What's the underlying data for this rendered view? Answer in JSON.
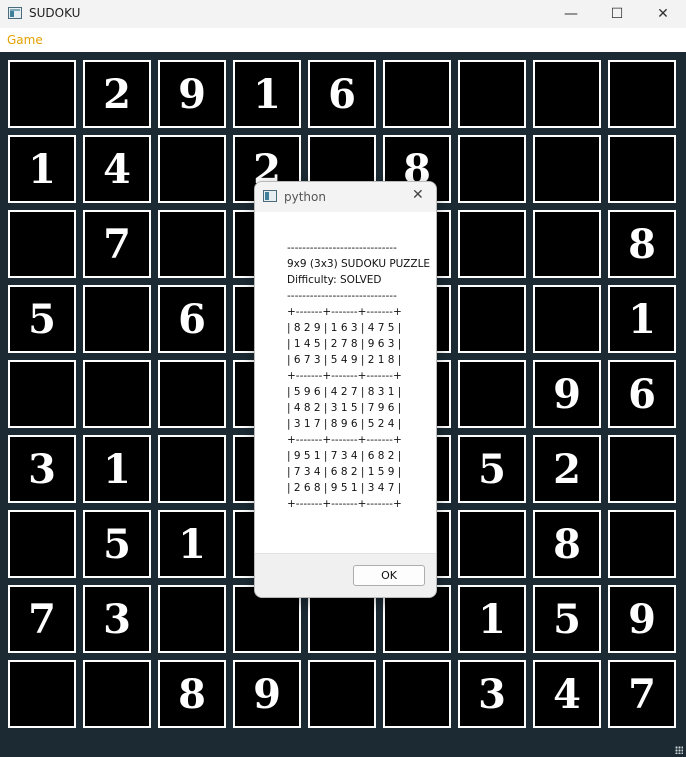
{
  "window": {
    "title": "SUDOKU",
    "controls": {
      "minimize": "—",
      "maximize": "☐",
      "close": "✕"
    }
  },
  "menu": {
    "items": [
      "Game"
    ]
  },
  "board": {
    "grid": [
      [
        "",
        "2",
        "9",
        "1",
        "6",
        "",
        "",
        "",
        ""
      ],
      [
        "1",
        "4",
        "",
        "2",
        "",
        "8",
        "",
        "",
        ""
      ],
      [
        "",
        "7",
        "",
        "",
        "",
        "",
        "",
        "",
        "8"
      ],
      [
        "5",
        "",
        "6",
        "",
        "",
        "",
        "",
        "",
        "1"
      ],
      [
        "",
        "",
        "",
        "",
        "",
        "",
        "",
        "9",
        "6"
      ],
      [
        "3",
        "1",
        "",
        "",
        "",
        "",
        "5",
        "2",
        ""
      ],
      [
        "",
        "5",
        "1",
        "",
        "",
        "",
        "",
        "8",
        ""
      ],
      [
        "7",
        "3",
        "",
        "",
        "",
        "",
        "1",
        "5",
        "9"
      ],
      [
        "",
        "",
        "8",
        "9",
        "",
        "",
        "3",
        "4",
        "7"
      ]
    ]
  },
  "dialog": {
    "title": "python",
    "close": "✕",
    "message_lines": [
      "-----------------------------",
      "9x9 (3x3) SUDOKU PUZZLE",
      "Difficulty: SOLVED",
      "-----------------------------",
      "+-------+-------+-------+",
      "| 8 2 9 | 1 6 3 | 4 7 5 |",
      "| 1 4 5 | 2 7 8 | 9 6 3 |",
      "| 6 7 3 | 5 4 9 | 2 1 8 |",
      "+-------+-------+-------+",
      "| 5 9 6 | 4 2 7 | 8 3 1 |",
      "| 4 8 2 | 3 1 5 | 7 9 6 |",
      "| 3 1 7 | 8 9 6 | 5 2 4 |",
      "+-------+-------+-------+",
      "| 9 5 1 | 7 3 4 | 6 8 2 |",
      "| 7 3 4 | 6 8 2 | 1 5 9 |",
      "| 2 6 8 | 9 5 1 | 3 4 7 |",
      "+-------+-------+-------+"
    ],
    "ok_label": "OK"
  }
}
